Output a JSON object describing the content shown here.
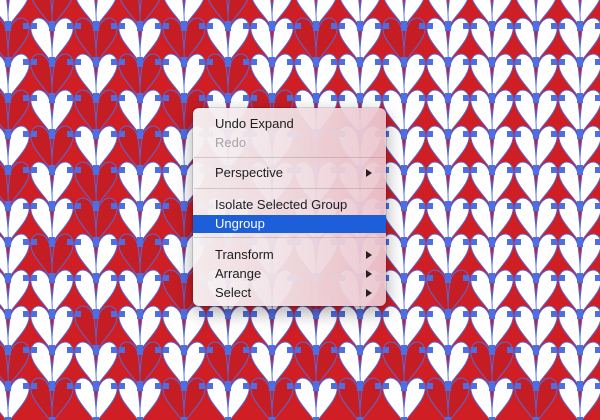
{
  "canvas": {
    "pattern": "knit-stitch",
    "colors": {
      "background": "#cf1f25",
      "white_stitch": "#ffffff",
      "red_stitch": "#c51d24",
      "stitch_outline": "#4d6fe6",
      "anchor_points": "#4d6fe6"
    }
  },
  "context_menu": {
    "colors": {
      "highlight": "#1c5fd8",
      "disabled_text": "#a9a2a4"
    },
    "items": [
      {
        "label": "Undo Expand",
        "enabled": true,
        "submenu": false
      },
      {
        "label": "Redo",
        "enabled": false,
        "submenu": false
      },
      {
        "label": "Perspective",
        "enabled": true,
        "submenu": true
      },
      {
        "label": "Isolate Selected Group",
        "enabled": true,
        "submenu": false
      },
      {
        "label": "Ungroup",
        "enabled": true,
        "submenu": false,
        "highlighted": true
      },
      {
        "label": "Transform",
        "enabled": true,
        "submenu": true
      },
      {
        "label": "Arrange",
        "enabled": true,
        "submenu": true
      },
      {
        "label": "Select",
        "enabled": true,
        "submenu": true
      }
    ]
  }
}
